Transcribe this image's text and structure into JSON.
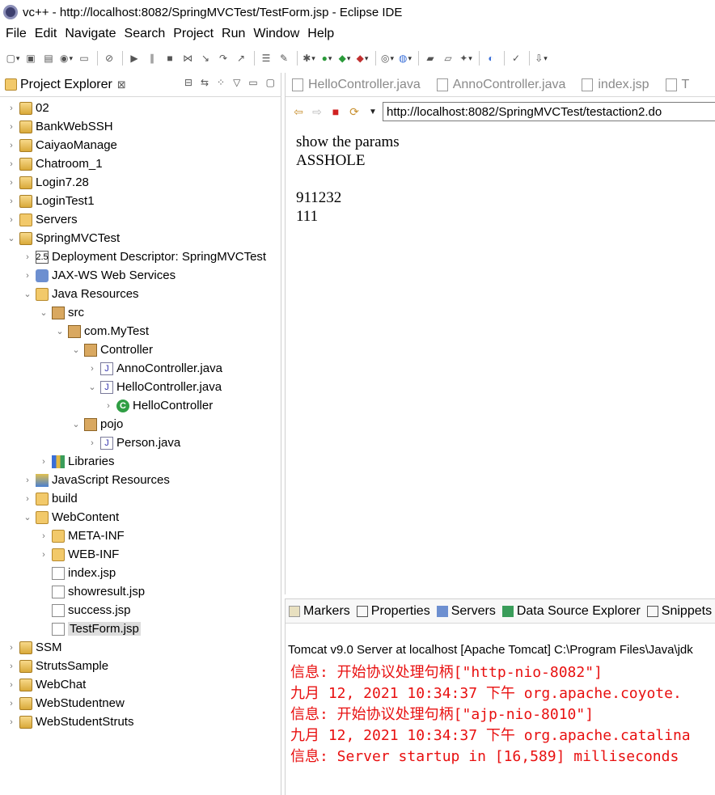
{
  "window": {
    "title": "vc++ - http://localhost:8082/SpringMVCTest/TestForm.jsp - Eclipse IDE"
  },
  "menu": [
    "File",
    "Edit",
    "Navigate",
    "Search",
    "Project",
    "Run",
    "Window",
    "Help"
  ],
  "explorer": {
    "tab_label": "Project Explorer",
    "close_glyph": "⊠",
    "tree": [
      {
        "label": "02",
        "indent": 0,
        "twisty": "›",
        "icon": "project"
      },
      {
        "label": "BankWebSSH",
        "indent": 0,
        "twisty": "›",
        "icon": "project"
      },
      {
        "label": "CaiyaoManage",
        "indent": 0,
        "twisty": "›",
        "icon": "project"
      },
      {
        "label": "Chatroom_1",
        "indent": 0,
        "twisty": "›",
        "icon": "project"
      },
      {
        "label": "Login7.28",
        "indent": 0,
        "twisty": "›",
        "icon": "project"
      },
      {
        "label": "LoginTest1",
        "indent": 0,
        "twisty": "›",
        "icon": "project"
      },
      {
        "label": "Servers",
        "indent": 0,
        "twisty": "›",
        "icon": "folder"
      },
      {
        "label": "SpringMVCTest",
        "indent": 0,
        "twisty": "⌄",
        "icon": "project"
      },
      {
        "label": "Deployment Descriptor: SpringMVCTest",
        "indent": 1,
        "twisty": "›",
        "icon": "dd"
      },
      {
        "label": "JAX-WS Web Services",
        "indent": 1,
        "twisty": "›",
        "icon": "ws"
      },
      {
        "label": "Java Resources",
        "indent": 1,
        "twisty": "⌄",
        "icon": "folder"
      },
      {
        "label": "src",
        "indent": 2,
        "twisty": "⌄",
        "icon": "pkg"
      },
      {
        "label": "com.MyTest",
        "indent": 3,
        "twisty": "⌄",
        "icon": "pkg"
      },
      {
        "label": "Controller",
        "indent": 4,
        "twisty": "⌄",
        "icon": "pkg"
      },
      {
        "label": "AnnoController.java",
        "indent": 5,
        "twisty": "›",
        "icon": "java"
      },
      {
        "label": "HelloController.java",
        "indent": 5,
        "twisty": "⌄",
        "icon": "java"
      },
      {
        "label": "HelloController",
        "indent": 6,
        "twisty": "›",
        "icon": "class"
      },
      {
        "label": "pojo",
        "indent": 4,
        "twisty": "⌄",
        "icon": "pkg"
      },
      {
        "label": "Person.java",
        "indent": 5,
        "twisty": "›",
        "icon": "java"
      },
      {
        "label": "Libraries",
        "indent": 2,
        "twisty": "›",
        "icon": "lib"
      },
      {
        "label": "JavaScript Resources",
        "indent": 1,
        "twisty": "›",
        "icon": "jsres"
      },
      {
        "label": "build",
        "indent": 1,
        "twisty": "›",
        "icon": "folder"
      },
      {
        "label": "WebContent",
        "indent": 1,
        "twisty": "⌄",
        "icon": "folder"
      },
      {
        "label": "META-INF",
        "indent": 2,
        "twisty": "›",
        "icon": "folder"
      },
      {
        "label": "WEB-INF",
        "indent": 2,
        "twisty": "›",
        "icon": "folder"
      },
      {
        "label": "index.jsp",
        "indent": 2,
        "twisty": "",
        "icon": "jsp"
      },
      {
        "label": "showresult.jsp",
        "indent": 2,
        "twisty": "",
        "icon": "jsp"
      },
      {
        "label": "success.jsp",
        "indent": 2,
        "twisty": "",
        "icon": "jsp"
      },
      {
        "label": "TestForm.jsp",
        "indent": 2,
        "twisty": "",
        "icon": "jsp",
        "selected": true
      },
      {
        "label": "SSM",
        "indent": 0,
        "twisty": "›",
        "icon": "project"
      },
      {
        "label": "StrutsSample",
        "indent": 0,
        "twisty": "›",
        "icon": "project"
      },
      {
        "label": "WebChat",
        "indent": 0,
        "twisty": "›",
        "icon": "project"
      },
      {
        "label": "WebStudentnew",
        "indent": 0,
        "twisty": "›",
        "icon": "project"
      },
      {
        "label": "WebStudentStruts",
        "indent": 0,
        "twisty": "›",
        "icon": "project"
      }
    ]
  },
  "editor": {
    "tabs": [
      "HelloController.java",
      "AnnoController.java",
      "index.jsp",
      "T"
    ],
    "url": "http://localhost:8082/SpringMVCTest/testaction2.do",
    "content": {
      "line1": "show the params",
      "line2": "ASSHOLE",
      "line3": "911232",
      "line4": "111"
    }
  },
  "console": {
    "tabs": [
      "Markers",
      "Properties",
      "Servers",
      "Data Source Explorer",
      "Snippets"
    ],
    "header": "Tomcat v9.0 Server at localhost [Apache Tomcat] C:\\Program Files\\Java\\jdk",
    "lines": [
      "信息: 开始协议处理句柄[\"http-nio-8082\"]",
      "九月 12, 2021 10:34:37 下午 org.apache.coyote.",
      "信息: 开始协议处理句柄[\"ajp-nio-8010\"]",
      "九月 12, 2021 10:34:37 下午 org.apache.catalina",
      "信息: Server startup in [16,589] milliseconds"
    ]
  }
}
